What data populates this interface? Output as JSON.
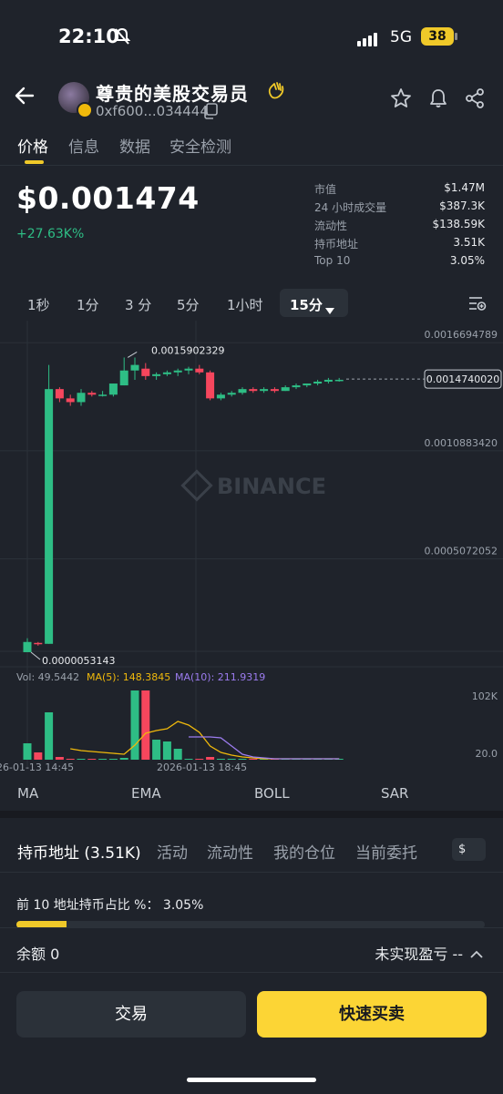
{
  "status_bar": {
    "time": "22:10",
    "network": "5G",
    "battery": "38"
  },
  "header": {
    "title": "尊贵的美股交易员",
    "address": "0xf600...034444",
    "icons": [
      "back-arrow-icon",
      "star-icon",
      "bell-icon",
      "share-icon",
      "copy-icon",
      "wave-hand-icon"
    ]
  },
  "tabs": [
    {
      "label": "价格",
      "active": true
    },
    {
      "label": "信息",
      "active": false
    },
    {
      "label": "数据",
      "active": false
    },
    {
      "label": "安全检测",
      "active": false
    }
  ],
  "price": {
    "value": "$0.001474",
    "change": "+27.63K%"
  },
  "stats": [
    {
      "label": "市值",
      "value": "$1.47M"
    },
    {
      "label": "24 小时成交量",
      "value": "$387.3K"
    },
    {
      "label": "流动性",
      "value": "$138.59K"
    },
    {
      "label": "持币地址",
      "value": "3.51K"
    },
    {
      "label": "Top 10",
      "value": "3.05%"
    }
  ],
  "intervals": [
    "1秒",
    "1分",
    "3 分",
    "5分",
    "1小时"
  ],
  "interval_selected": "15分",
  "chart_data": {
    "type": "candlestick",
    "price_axis_labels": [
      "0.0016694789",
      "0.0010883420",
      "0.0005072052"
    ],
    "current_price_label": "0.0014740020",
    "high_marker": "0.0015902329",
    "low_marker": "0.0000053143",
    "watermark": "BINANCE",
    "ylim": [
      0,
      0.0017
    ],
    "candles": [
      {
        "o": 5e-06,
        "h": 8e-05,
        "l": 5e-06,
        "c": 6e-05
      },
      {
        "o": 5.5e-05,
        "h": 6e-05,
        "l": 4e-05,
        "c": 5e-05
      },
      {
        "o": 5e-05,
        "h": 0.00155,
        "l": 5e-05,
        "c": 0.00142
      },
      {
        "o": 0.00142,
        "h": 0.00143,
        "l": 0.00135,
        "c": 0.00137
      },
      {
        "o": 0.00137,
        "h": 0.00139,
        "l": 0.00133,
        "c": 0.00135
      },
      {
        "o": 0.00135,
        "h": 0.00142,
        "l": 0.00133,
        "c": 0.0014
      },
      {
        "o": 0.0014,
        "h": 0.00141,
        "l": 0.00138,
        "c": 0.00139
      },
      {
        "o": 0.00139,
        "h": 0.00141,
        "l": 0.00138,
        "c": 0.00139
      },
      {
        "o": 0.00139,
        "h": 0.00145,
        "l": 0.00138,
        "c": 0.00145
      },
      {
        "o": 0.00144,
        "h": 0.00159,
        "l": 0.00144,
        "c": 0.00152
      },
      {
        "o": 0.00152,
        "h": 0.00159,
        "l": 0.00147,
        "c": 0.00155
      },
      {
        "o": 0.00153,
        "h": 0.00156,
        "l": 0.00147,
        "c": 0.00149
      },
      {
        "o": 0.00149,
        "h": 0.00151,
        "l": 0.00147,
        "c": 0.0015
      },
      {
        "o": 0.0015,
        "h": 0.00152,
        "l": 0.00149,
        "c": 0.00151
      },
      {
        "o": 0.00151,
        "h": 0.00153,
        "l": 0.00149,
        "c": 0.00152
      },
      {
        "o": 0.00152,
        "h": 0.00154,
        "l": 0.0015,
        "c": 0.00153
      },
      {
        "o": 0.00153,
        "h": 0.00155,
        "l": 0.0015,
        "c": 0.00151
      },
      {
        "o": 0.00151,
        "h": 0.00152,
        "l": 0.00136,
        "c": 0.00137
      },
      {
        "o": 0.00137,
        "h": 0.0014,
        "l": 0.00136,
        "c": 0.00139
      },
      {
        "o": 0.00139,
        "h": 0.00141,
        "l": 0.00138,
        "c": 0.0014
      },
      {
        "o": 0.0014,
        "h": 0.00143,
        "l": 0.00139,
        "c": 0.00142
      },
      {
        "o": 0.00142,
        "h": 0.00143,
        "l": 0.0014,
        "c": 0.00141
      },
      {
        "o": 0.00141,
        "h": 0.00143,
        "l": 0.0014,
        "c": 0.00142
      },
      {
        "o": 0.00142,
        "h": 0.00143,
        "l": 0.0014,
        "c": 0.00141
      },
      {
        "o": 0.00141,
        "h": 0.00144,
        "l": 0.00141,
        "c": 0.00143
      },
      {
        "o": 0.00143,
        "h": 0.00145,
        "l": 0.00142,
        "c": 0.00144
      },
      {
        "o": 0.00144,
        "h": 0.00145,
        "l": 0.00143,
        "c": 0.00145
      },
      {
        "o": 0.00145,
        "h": 0.00147,
        "l": 0.00144,
        "c": 0.00146
      },
      {
        "o": 0.00146,
        "h": 0.00148,
        "l": 0.00145,
        "c": 0.00147
      },
      {
        "o": 0.00147,
        "h": 0.00148,
        "l": 0.00146,
        "c": 0.00147
      }
    ],
    "volume": {
      "vol_label": "Vol: 49.5442",
      "ma5_label": "MA(5): 148.3845",
      "ma10_label": "MA(10): 211.9319",
      "axis_labels": [
        "102K",
        "20.0"
      ],
      "values": [
        18,
        8,
        52,
        3,
        1,
        1,
        1,
        1,
        1,
        2,
        76,
        76,
        22,
        20,
        12,
        1,
        1,
        3,
        1,
        1,
        1,
        1,
        1,
        1,
        1,
        1,
        1,
        1,
        1,
        1
      ],
      "ma5": [
        null,
        null,
        null,
        null,
        12,
        10,
        9,
        8,
        7,
        6,
        16,
        29,
        32,
        34,
        42,
        38,
        30,
        15,
        8,
        5,
        3,
        2,
        1,
        1,
        1,
        1,
        1,
        1,
        1,
        1
      ],
      "ma10": [
        null,
        null,
        null,
        null,
        null,
        null,
        null,
        null,
        null,
        null,
        null,
        null,
        null,
        null,
        null,
        25,
        25,
        25,
        24,
        15,
        6,
        3,
        2,
        1,
        1,
        1,
        1,
        1,
        1,
        1
      ],
      "max": 102000
    },
    "x_labels": [
      "26-01-13 14:45",
      "2026-01-13 18:45"
    ]
  },
  "indicators": [
    "MA",
    "EMA",
    "BOLL",
    "SAR"
  ],
  "section_tabs": [
    {
      "label": "持币地址 (3.51K)",
      "active": true
    },
    {
      "label": "活动",
      "active": false
    },
    {
      "label": "流动性",
      "active": false
    },
    {
      "label": "我的仓位",
      "active": false
    },
    {
      "label": "当前委托",
      "active": false
    }
  ],
  "currency_button": "$",
  "top10": {
    "text": "前 10 地址持币占比 %： 3.05%",
    "fraction": 0.0305
  },
  "balance": {
    "label": "余额 0",
    "pnl": "未实现盈亏 --"
  },
  "buttons": {
    "trade": "交易",
    "quick": "快速买卖"
  },
  "colors": {
    "up": "#2ebd85",
    "down": "#f6465d",
    "accent": "#fcd535",
    "ma5": "#f0b90b",
    "ma10": "#9c7cf0"
  }
}
